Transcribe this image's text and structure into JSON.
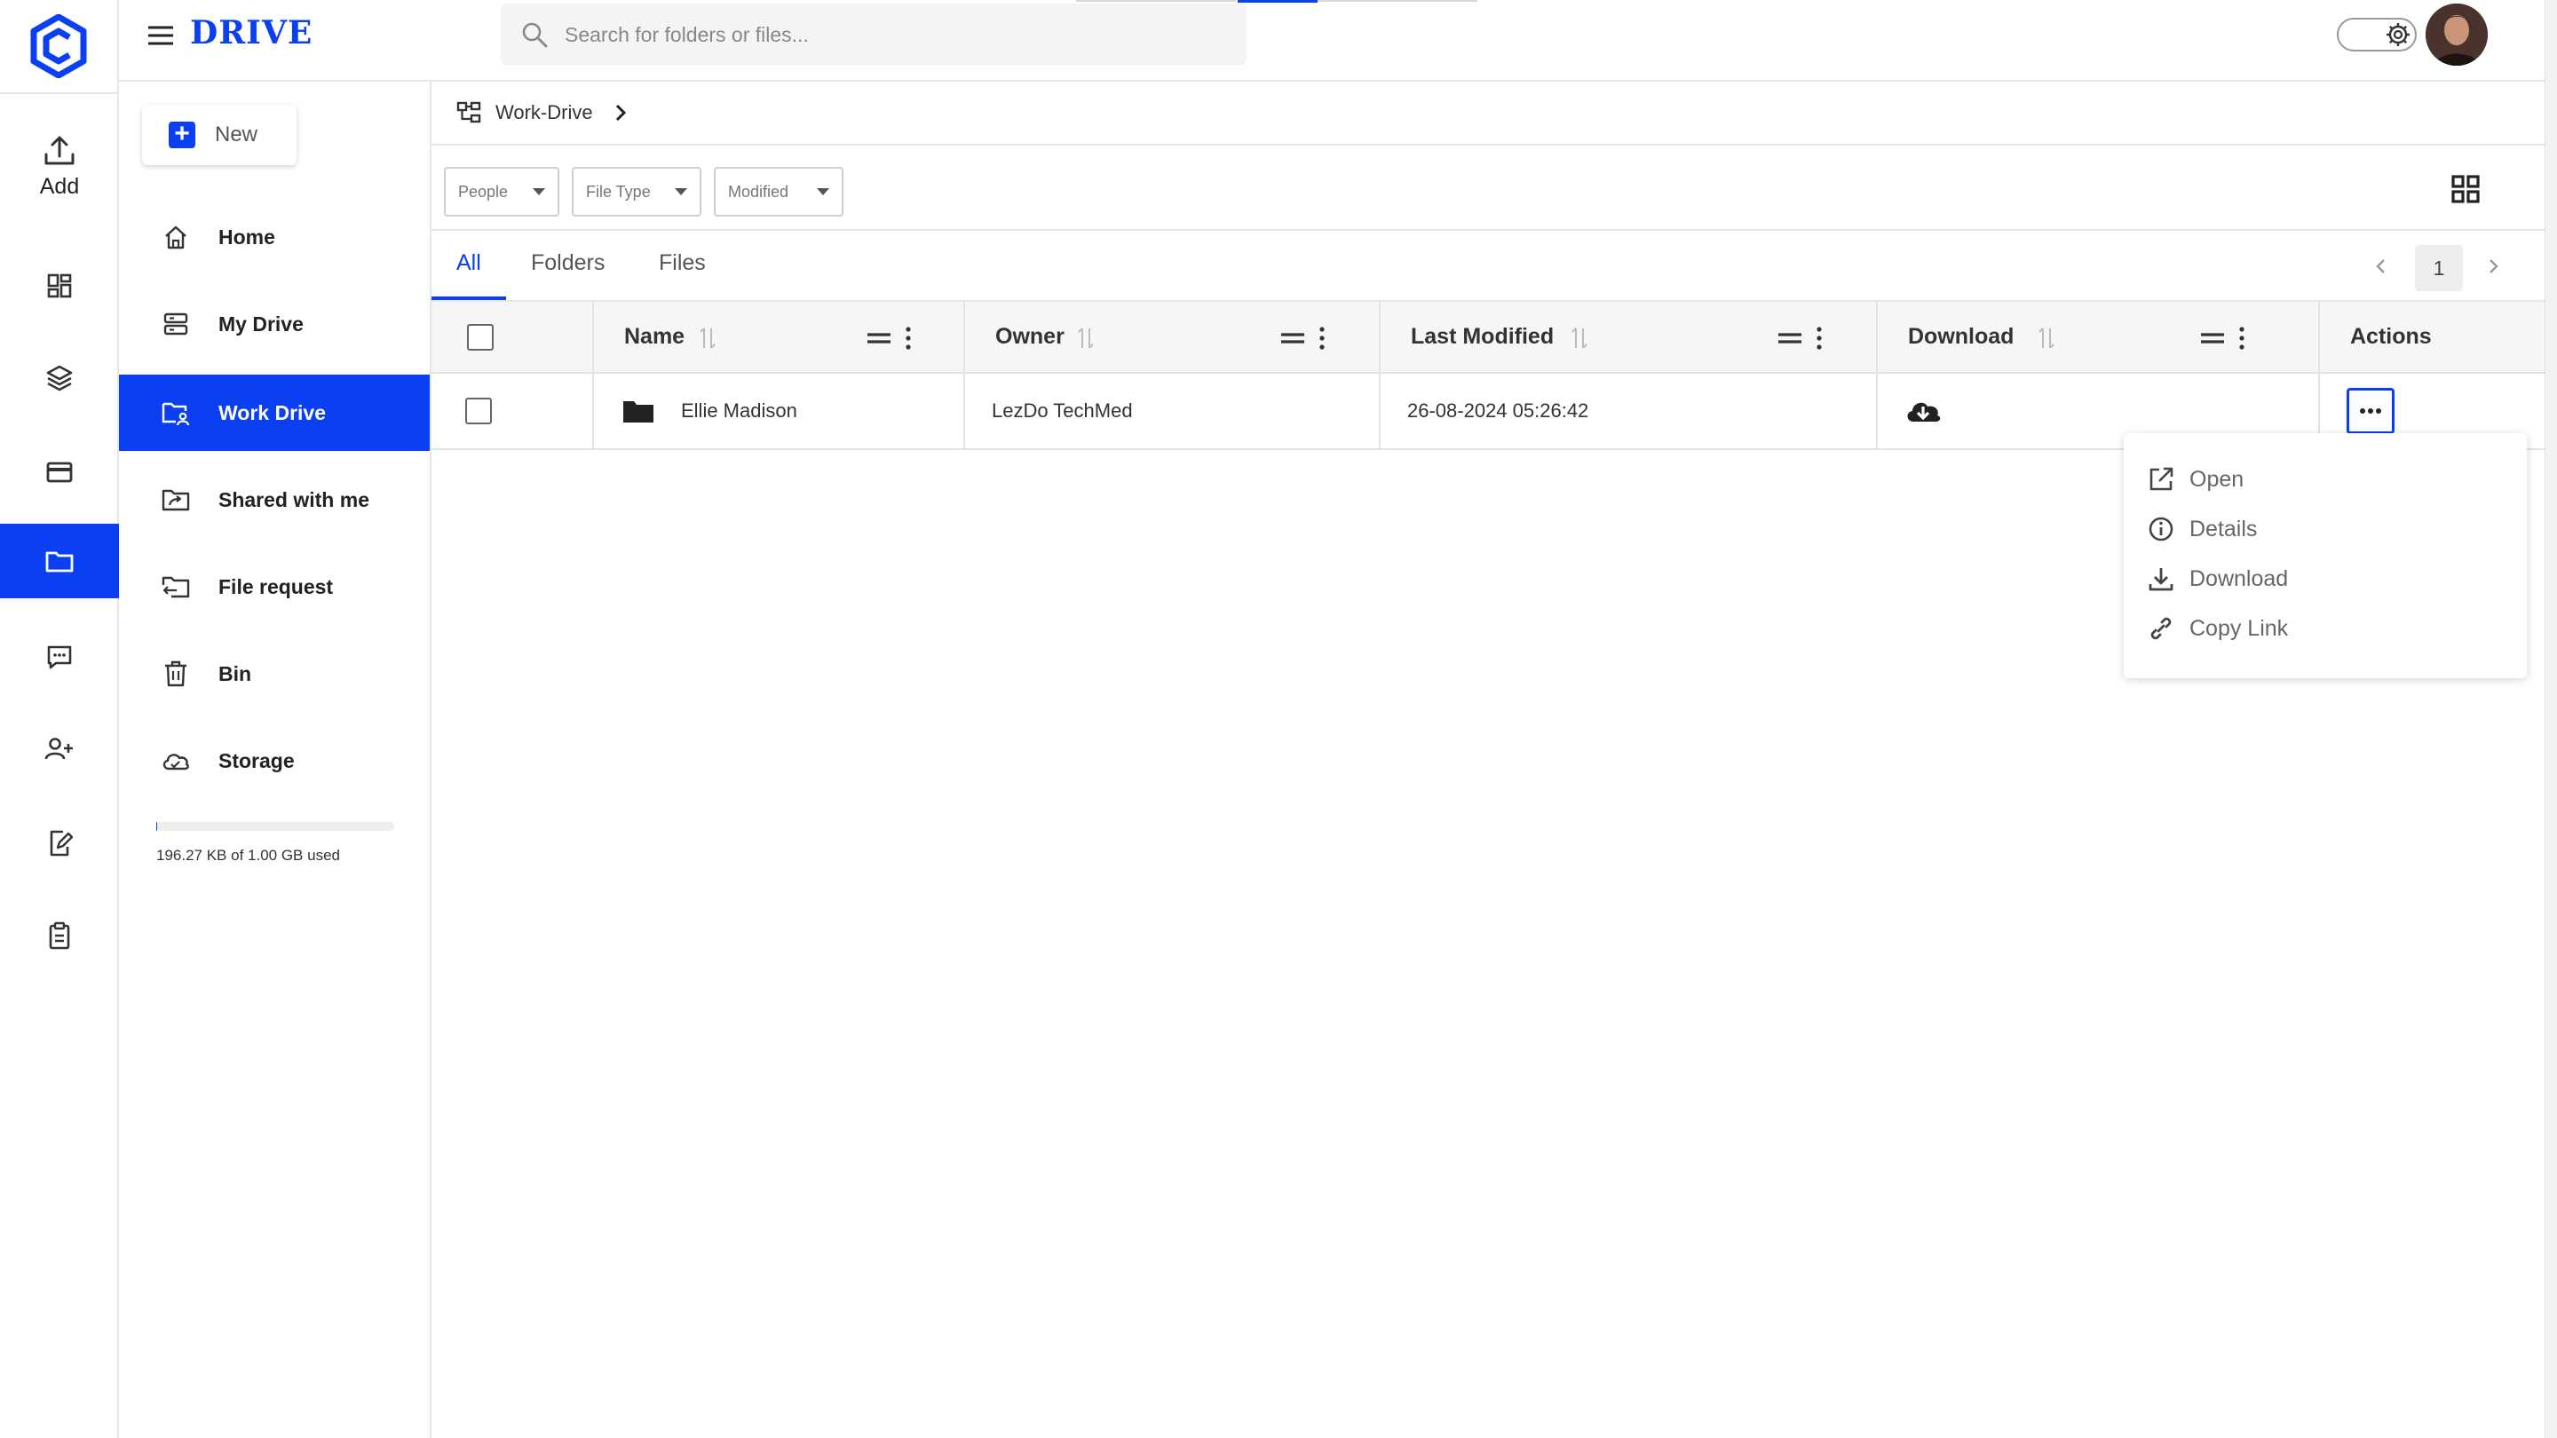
{
  "app": {
    "brand": "DRIVE",
    "rail_add_label": "Add"
  },
  "search": {
    "placeholder": "Search for folders or files..."
  },
  "rail": {
    "items": [
      {
        "icon": "dashboard-icon"
      },
      {
        "icon": "layers-icon"
      },
      {
        "icon": "card-icon"
      },
      {
        "icon": "folder-icon",
        "active": true
      },
      {
        "icon": "chat-icon"
      },
      {
        "icon": "user-add-icon"
      },
      {
        "icon": "edit-document-icon"
      },
      {
        "icon": "clipboard-icon"
      }
    ]
  },
  "sidebar": {
    "new_label": "New",
    "items": [
      {
        "label": "Home",
        "icon": "home-icon"
      },
      {
        "label": "My Drive",
        "icon": "server-icon"
      },
      {
        "label": "Work Drive",
        "icon": "work-drive-icon",
        "active": true
      },
      {
        "label": "Shared with me",
        "icon": "shared-folder-icon"
      },
      {
        "label": "File request",
        "icon": "file-request-icon"
      },
      {
        "label": "Bin",
        "icon": "trash-icon"
      },
      {
        "label": "Storage",
        "icon": "cloud-icon"
      }
    ],
    "storage_text": "196.27 KB of 1.00 GB used",
    "storage_used_fraction": 0.0002
  },
  "breadcrumb": {
    "label": "Work-Drive"
  },
  "filters": {
    "people": "People",
    "file_type": "File Type",
    "modified": "Modified"
  },
  "tabs": [
    "All",
    "Folders",
    "Files"
  ],
  "pagination": {
    "current_page": "1"
  },
  "table": {
    "columns": [
      "Name",
      "Owner",
      "Last Modified",
      "Download",
      "Actions"
    ],
    "rows": [
      {
        "name": "Ellie Madison",
        "owner": "LezDo TechMed",
        "last_modified": "26-08-2024 05:26:42"
      }
    ]
  },
  "actions_menu": {
    "items": [
      "Open",
      "Details",
      "Download",
      "Copy Link"
    ]
  },
  "colors": {
    "accent": "#0a3ff2",
    "text": "#222222",
    "border": "#e6e6e6"
  }
}
